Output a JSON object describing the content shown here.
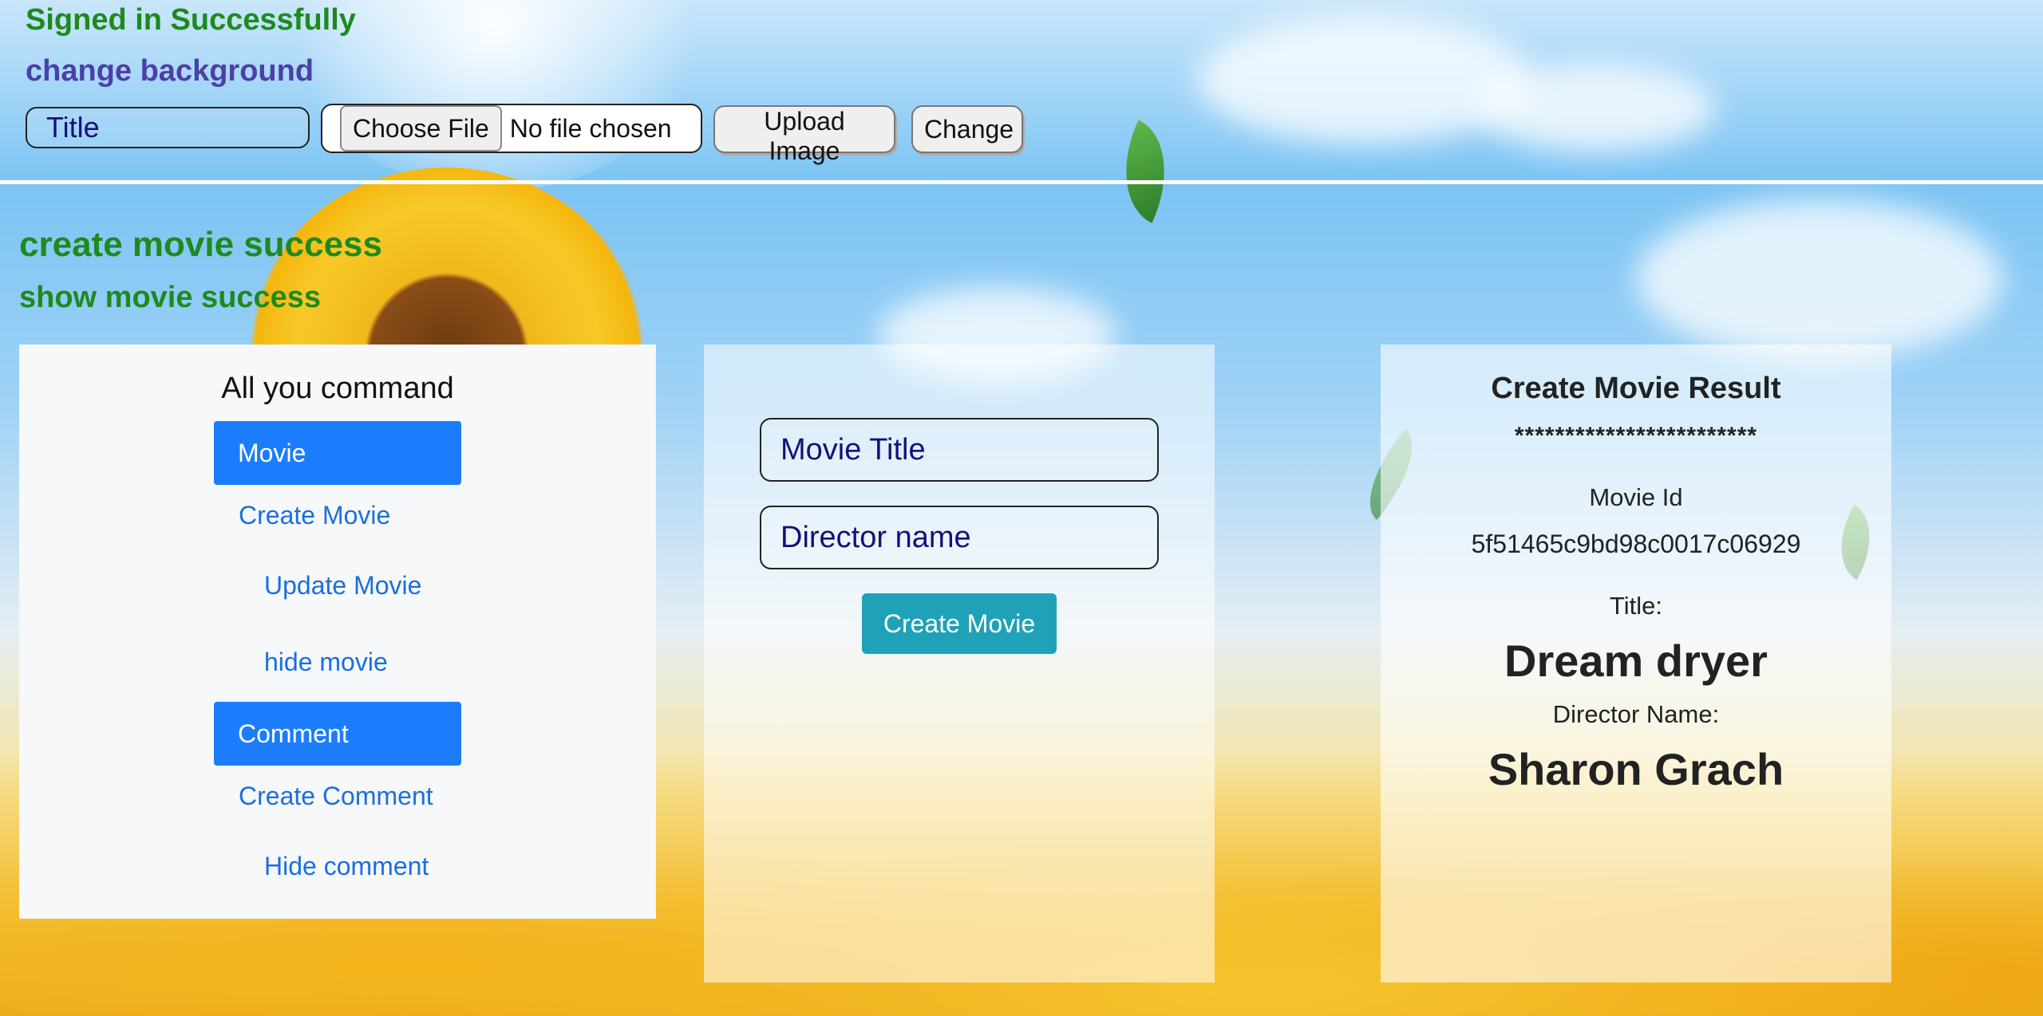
{
  "header": {
    "signed_message": "Signed in Successfully",
    "change_background_label": "change background",
    "title_placeholder": "Title",
    "file_button_label": "Choose File",
    "file_status": "No file chosen",
    "upload_button_label": "Upload Image",
    "change_button_label": "Change"
  },
  "messages": {
    "create_movie": "create movie success",
    "show_movie": "show movie success"
  },
  "command_panel": {
    "title": "All you command",
    "movie_section": "Movie",
    "create_movie": "Create Movie",
    "update_movie": "Update Movie",
    "hide_movie": "hide movie",
    "comment_section": "Comment",
    "create_comment": "Create Comment",
    "hide_comment": "Hide comment"
  },
  "form": {
    "movie_title_placeholder": "Movie Title",
    "director_placeholder": "Director name",
    "submit_label": "Create Movie"
  },
  "result": {
    "title": "Create Movie Result",
    "separator": "************************",
    "id_label": "Movie Id",
    "id_value": "5f51465c9bd98c0017c06929",
    "title_label": "Title:",
    "title_value": "Dream dryer",
    "director_label": "Director Name:",
    "director_value": "Sharon Grach"
  },
  "colors": {
    "success_text": "#1e8a1e",
    "accent_text": "#4b3fa8",
    "primary_button": "#1b7dfb",
    "info_button": "#1fa2b8",
    "link": "#1a6fe0"
  }
}
